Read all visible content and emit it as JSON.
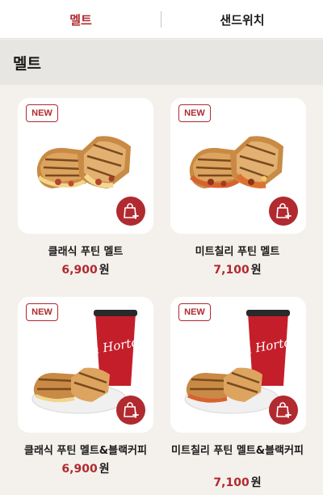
{
  "tabs": [
    {
      "label": "멜트",
      "active": true
    },
    {
      "label": "샌드위치",
      "active": false
    }
  ],
  "section": {
    "title": "멜트"
  },
  "badge_text": "NEW",
  "cup_text": "Tim Hortons",
  "currency": "원",
  "accent_color": "#b02a30",
  "products": [
    {
      "name": "클래식 푸틴 멜트",
      "price": "6,900",
      "new": true,
      "image": "panini-sandwich"
    },
    {
      "name": "미트칠리 푸틴 멜트",
      "price": "7,100",
      "new": true,
      "image": "panini-sandwich"
    },
    {
      "name": "클래식 푸틴 멜트&블랙커피",
      "price": "6,900",
      "new": true,
      "image": "panini-with-coffee-cup"
    },
    {
      "name": "미트칠리 푸틴 멜트&블랙커피",
      "price": "7,100",
      "new": true,
      "image": "panini-with-coffee-cup"
    }
  ]
}
